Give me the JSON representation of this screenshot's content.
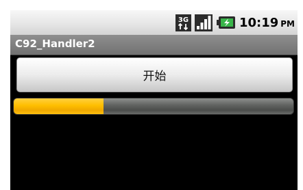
{
  "status_bar": {
    "network_label": "3G",
    "time": "10:19",
    "ampm": "PM",
    "icons": [
      "3g-icon",
      "signal-strength-icon",
      "battery-charging-icon"
    ]
  },
  "app": {
    "title": "C92_Handler2"
  },
  "main": {
    "start_button_label": "开始",
    "progress": {
      "value_fraction": 0.32
    }
  },
  "colors": {
    "progress_fill": "#ffbe00",
    "progress_track": "#5f615f",
    "title_bar": "#7e7e7e",
    "screen_background": "#000000"
  }
}
